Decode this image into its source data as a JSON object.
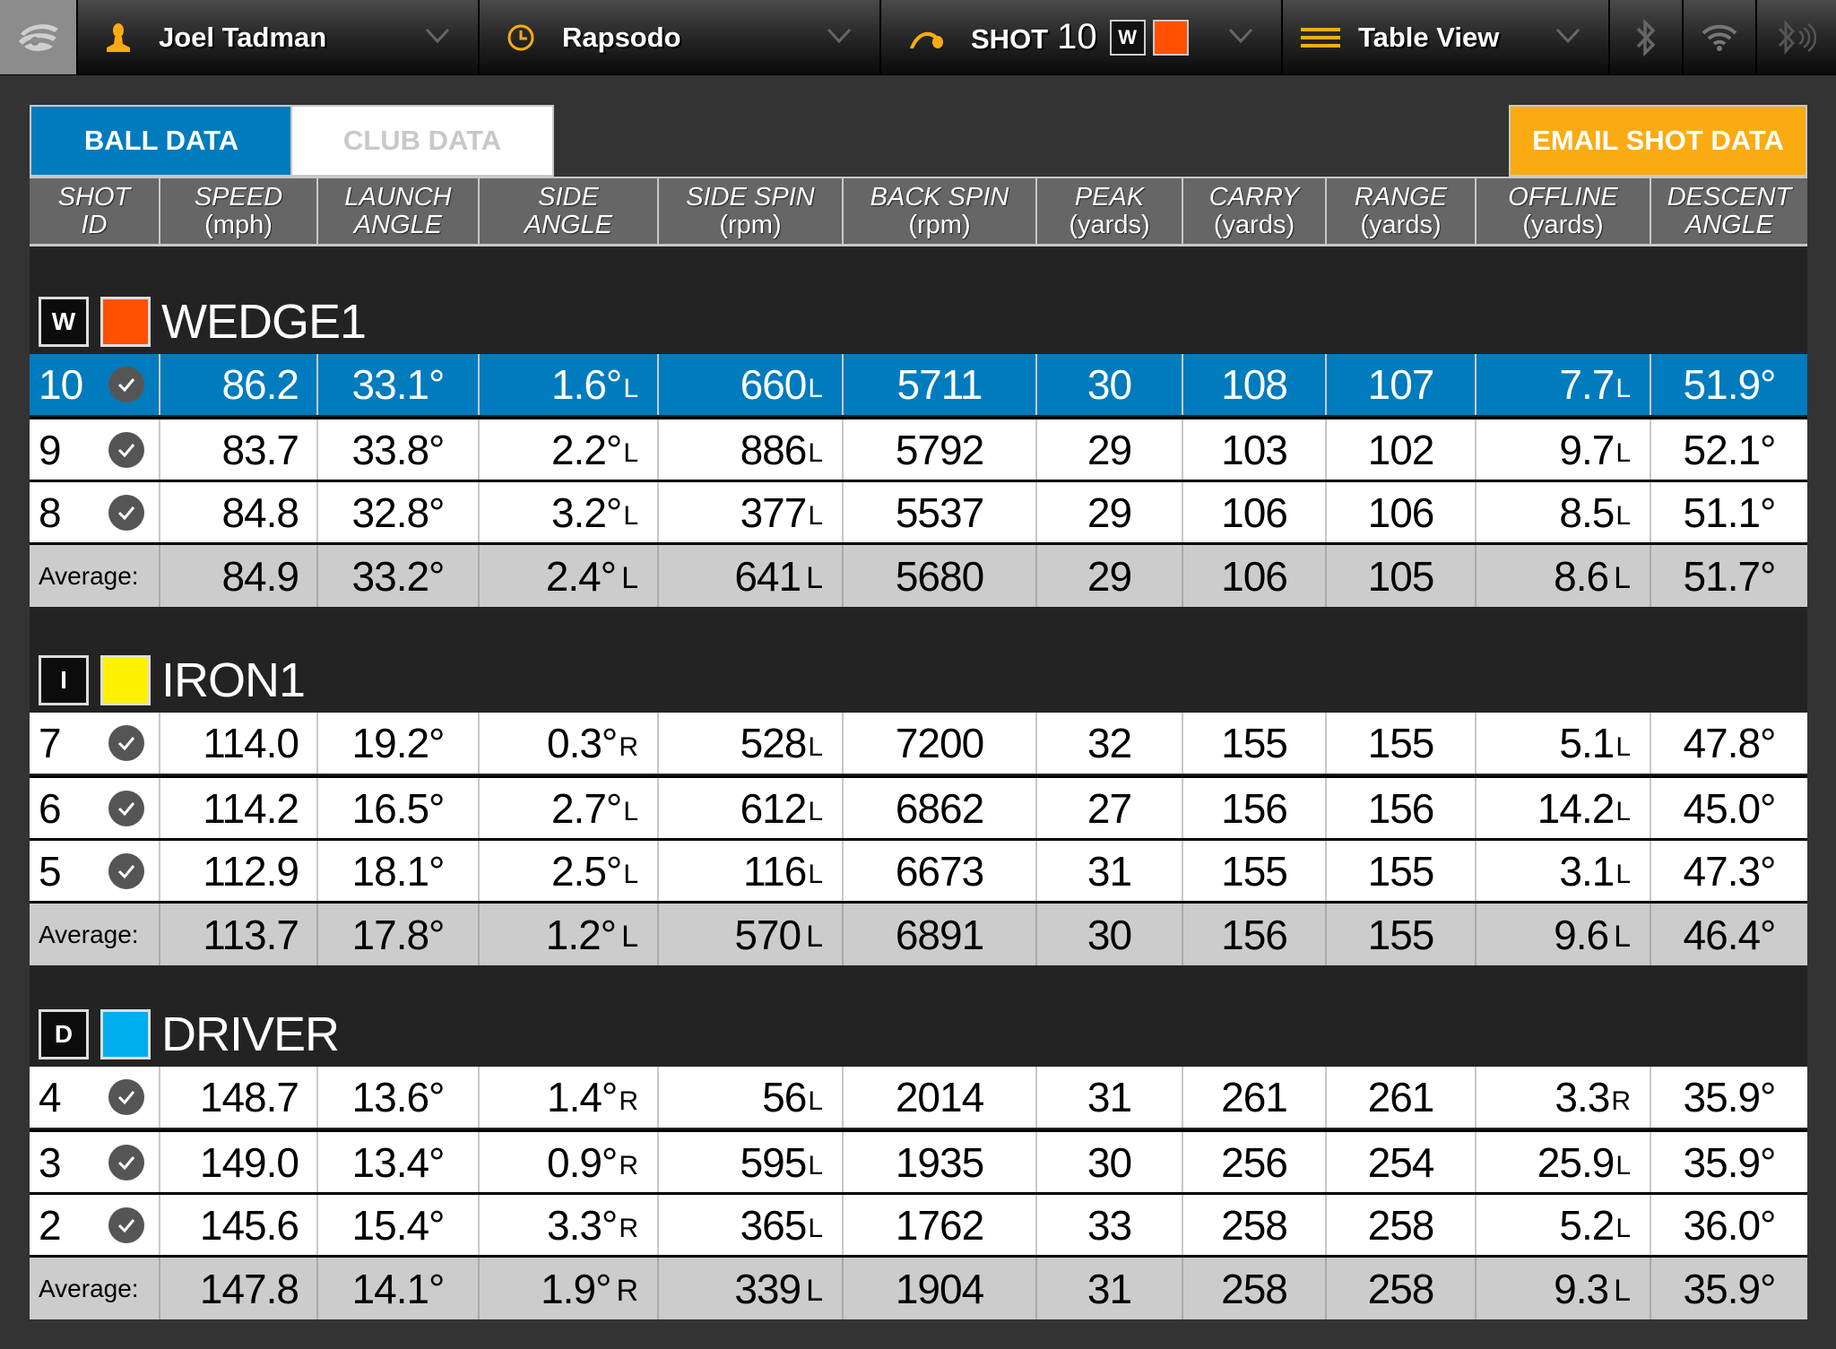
{
  "topbar": {
    "logo_icon": "app-logo-icon",
    "player": {
      "icon": "person-icon",
      "label": "Joel Tadman"
    },
    "device": {
      "icon": "clock-icon",
      "label": "Rapsodo"
    },
    "shot": {
      "icon": "ball-flight-icon",
      "label": "SHOT",
      "number": "10",
      "club_letter": "W",
      "club_color": "#ff5100"
    },
    "view": {
      "icon": "menu-lines-icon",
      "label": "Table View"
    },
    "status_icons": [
      "bluetooth-icon",
      "wifi-icon",
      "bluetooth-signal-icon"
    ]
  },
  "tabs": {
    "ball_data": "BALL DATA",
    "club_data": "CLUB DATA",
    "active": "ball_data"
  },
  "email_button": "EMAIL SHOT DATA",
  "colors": {
    "accent_blue": "#007bbd",
    "email_orange": "#fbab12",
    "wedge": "#ff5100",
    "iron": "#fff200",
    "driver": "#00aeef"
  },
  "columns": [
    {
      "line1": "SHOT",
      "line2": "ID",
      "line2_italic": true
    },
    {
      "line1": "SPEED",
      "line2": "(mph)",
      "line2_italic": false
    },
    {
      "line1": "LAUNCH",
      "line2": "ANGLE",
      "line2_italic": true
    },
    {
      "line1": "SIDE",
      "line2": "ANGLE",
      "line2_italic": true
    },
    {
      "line1": "SIDE SPIN",
      "line2": "(rpm)",
      "line2_italic": false
    },
    {
      "line1": "BACK SPIN",
      "line2": "(rpm)",
      "line2_italic": false
    },
    {
      "line1": "PEAK",
      "line2": "(yards)",
      "line2_italic": false
    },
    {
      "line1": "CARRY",
      "line2": "(yards)",
      "line2_italic": false
    },
    {
      "line1": "RANGE",
      "line2": "(yards)",
      "line2_italic": false
    },
    {
      "line1": "OFFLINE",
      "line2": "(yards)",
      "line2_italic": false
    },
    {
      "line1": "DESCENT",
      "line2": "ANGLE",
      "line2_italic": true
    }
  ],
  "average_label": "Average:",
  "groups": [
    {
      "letter": "W",
      "name": "WEDGE1",
      "color": "#ff5100",
      "shots": [
        {
          "id": "10",
          "selected": true,
          "checked": true,
          "speed": "86.2",
          "launch": "33.1°",
          "side_angle": "1.6°",
          "side_angle_dir": "L",
          "side_spin": "660",
          "side_spin_dir": "L",
          "back_spin": "5711",
          "peak": "30",
          "carry": "108",
          "range": "107",
          "offline": "7.7",
          "offline_dir": "L",
          "descent": "51.9°"
        },
        {
          "id": "9",
          "selected": false,
          "checked": true,
          "speed": "83.7",
          "launch": "33.8°",
          "side_angle": "2.2°",
          "side_angle_dir": "L",
          "side_spin": "886",
          "side_spin_dir": "L",
          "back_spin": "5792",
          "peak": "29",
          "carry": "103",
          "range": "102",
          "offline": "9.7",
          "offline_dir": "L",
          "descent": "52.1°"
        },
        {
          "id": "8",
          "selected": false,
          "checked": true,
          "speed": "84.8",
          "launch": "32.8°",
          "side_angle": "3.2°",
          "side_angle_dir": "L",
          "side_spin": "377",
          "side_spin_dir": "L",
          "back_spin": "5537",
          "peak": "29",
          "carry": "106",
          "range": "106",
          "offline": "8.5",
          "offline_dir": "L",
          "descent": "51.1°"
        }
      ],
      "average": {
        "speed": "84.9",
        "launch": "33.2°",
        "side_angle": "2.4°",
        "side_angle_dir": "L",
        "side_spin": "641",
        "side_spin_dir": "L",
        "back_spin": "5680",
        "peak": "29",
        "carry": "106",
        "range": "105",
        "offline": "8.6",
        "offline_dir": "L",
        "descent": "51.7°"
      }
    },
    {
      "letter": "I",
      "name": "IRON1",
      "color": "#fff200",
      "shots": [
        {
          "id": "7",
          "selected": false,
          "checked": true,
          "speed": "114.0",
          "launch": "19.2°",
          "side_angle": "0.3°",
          "side_angle_dir": "R",
          "side_spin": "528",
          "side_spin_dir": "L",
          "back_spin": "7200",
          "peak": "32",
          "carry": "155",
          "range": "155",
          "offline": "5.1",
          "offline_dir": "L",
          "descent": "47.8°"
        },
        {
          "id": "6",
          "selected": false,
          "checked": true,
          "speed": "114.2",
          "launch": "16.5°",
          "side_angle": "2.7°",
          "side_angle_dir": "L",
          "side_spin": "612",
          "side_spin_dir": "L",
          "back_spin": "6862",
          "peak": "27",
          "carry": "156",
          "range": "156",
          "offline": "14.2",
          "offline_dir": "L",
          "descent": "45.0°"
        },
        {
          "id": "5",
          "selected": false,
          "checked": true,
          "speed": "112.9",
          "launch": "18.1°",
          "side_angle": "2.5°",
          "side_angle_dir": "L",
          "side_spin": "116",
          "side_spin_dir": "L",
          "back_spin": "6673",
          "peak": "31",
          "carry": "155",
          "range": "155",
          "offline": "3.1",
          "offline_dir": "L",
          "descent": "47.3°"
        }
      ],
      "average": {
        "speed": "113.7",
        "launch": "17.8°",
        "side_angle": "1.2°",
        "side_angle_dir": "L",
        "side_spin": "570",
        "side_spin_dir": "L",
        "back_spin": "6891",
        "peak": "30",
        "carry": "156",
        "range": "155",
        "offline": "9.6",
        "offline_dir": "L",
        "descent": "46.4°"
      }
    },
    {
      "letter": "D",
      "name": "DRIVER",
      "color": "#00aeef",
      "shots": [
        {
          "id": "4",
          "selected": false,
          "checked": true,
          "speed": "148.7",
          "launch": "13.6°",
          "side_angle": "1.4°",
          "side_angle_dir": "R",
          "side_spin": "56",
          "side_spin_dir": "L",
          "back_spin": "2014",
          "peak": "31",
          "carry": "261",
          "range": "261",
          "offline": "3.3",
          "offline_dir": "R",
          "descent": "35.9°"
        },
        {
          "id": "3",
          "selected": false,
          "checked": true,
          "speed": "149.0",
          "launch": "13.4°",
          "side_angle": "0.9°",
          "side_angle_dir": "R",
          "side_spin": "595",
          "side_spin_dir": "L",
          "back_spin": "1935",
          "peak": "30",
          "carry": "256",
          "range": "254",
          "offline": "25.9",
          "offline_dir": "L",
          "descent": "35.9°"
        },
        {
          "id": "2",
          "selected": false,
          "checked": true,
          "speed": "145.6",
          "launch": "15.4°",
          "side_angle": "3.3°",
          "side_angle_dir": "R",
          "side_spin": "365",
          "side_spin_dir": "L",
          "back_spin": "1762",
          "peak": "33",
          "carry": "258",
          "range": "258",
          "offline": "5.2",
          "offline_dir": "L",
          "descent": "36.0°"
        }
      ],
      "average": {
        "speed": "147.8",
        "launch": "14.1°",
        "side_angle": "1.9°",
        "side_angle_dir": "R",
        "side_spin": "339",
        "side_spin_dir": "L",
        "back_spin": "1904",
        "peak": "31",
        "carry": "258",
        "range": "258",
        "offline": "9.3",
        "offline_dir": "L",
        "descent": "35.9°"
      }
    }
  ]
}
